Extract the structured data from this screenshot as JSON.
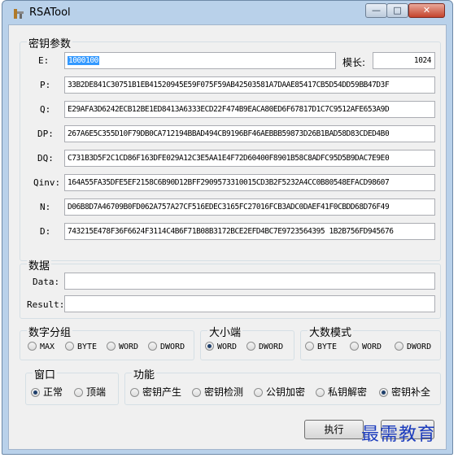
{
  "window": {
    "title": "RSATool",
    "min_glyph": "—",
    "max_glyph": "□",
    "close_glyph": "✕"
  },
  "key_params": {
    "legend": "密钥参数",
    "e_label": "E:",
    "e_value": "1000100",
    "modulus_label": "模长:",
    "modulus_value": "1024",
    "fields": [
      {
        "label": "P:",
        "value": "33B2DE841C30751B1EB41520945E59F075F59AB42503581A7DAAE85417CB5D54DD59BB47D3F"
      },
      {
        "label": "Q:",
        "value": "E29AFA3D6242ECB12BE1ED8413A6333ECD22F474B9EACA80ED6F67817D1C7C9512AFE653A9D"
      },
      {
        "label": "DP:",
        "value": "267A6E5C355D10F79DB0CA712194BBAD494CB9196BF46AEBBB59873D26B1BAD58D83CDED4B0"
      },
      {
        "label": "DQ:",
        "value": "C731B3D5F2C1CD86F163DFE029A12C3E5AA1E4F72D60400F8901B58C8ADFC95D5B9DAC7E9E0"
      },
      {
        "label": "Qinv:",
        "value": "164A55FA35DFE5EF2158C6B90D12BFF2909573310015CD3B2F5232A4CC0B80548EFACD98607"
      },
      {
        "label": "N:",
        "value": "D06B8D7A46709B0FD062A757A27CF516EDEC3165FC27016FCB3ADC0DAEF41F0CBDD68D76F49"
      },
      {
        "label": "D:",
        "value": "743215E478F36F6624F3114C4B6F71B08B3172BCE2EFD4BC7E9723564395 1B2B756FD945676"
      }
    ]
  },
  "data_group": {
    "legend": "数据",
    "data_label": "Data:",
    "data_value": "",
    "result_label": "Result:",
    "result_value": ""
  },
  "number_group": {
    "legend": "数字分组",
    "options": [
      "MAX",
      "BYTE",
      "WORD",
      "DWORD"
    ]
  },
  "endian_group": {
    "legend": "大小端",
    "options": [
      "WORD",
      "DWORD"
    ],
    "selected": "WORD"
  },
  "bignum_group": {
    "legend": "大数模式",
    "options": [
      "BYTE",
      "WORD",
      "DWORD"
    ]
  },
  "window_group": {
    "legend": "窗口",
    "options": [
      "正常",
      "顶端"
    ],
    "selected": "正常"
  },
  "function_group": {
    "legend": "功能",
    "options": [
      "密钥产生",
      "密钥检测",
      "公钥加密",
      "私钥解密",
      "密钥补全"
    ],
    "selected": "密钥补全"
  },
  "buttons": {
    "execute": "执行"
  },
  "watermark": "最需教育"
}
